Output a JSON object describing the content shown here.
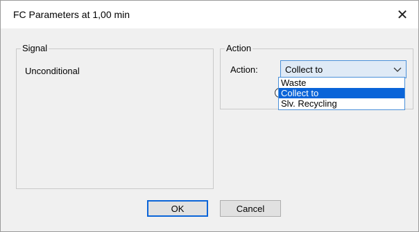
{
  "dialog": {
    "title": "FC Parameters at 1,00 min",
    "close_symbol": "✕"
  },
  "signal": {
    "group_label": "Signal",
    "value": "Unconditional"
  },
  "action": {
    "group_label": "Action",
    "field_label": "Action:",
    "selected": "Collect to",
    "options": [
      "Waste",
      "Collect to",
      "Slv. Recycling"
    ],
    "selected_index": 1
  },
  "buttons": {
    "ok_label": "OK",
    "cancel_label": "Cancel"
  },
  "colors": {
    "accent": "#0a64d8",
    "combo_bg": "#dfeaf6",
    "dialog_bg": "#f0f0f0"
  }
}
